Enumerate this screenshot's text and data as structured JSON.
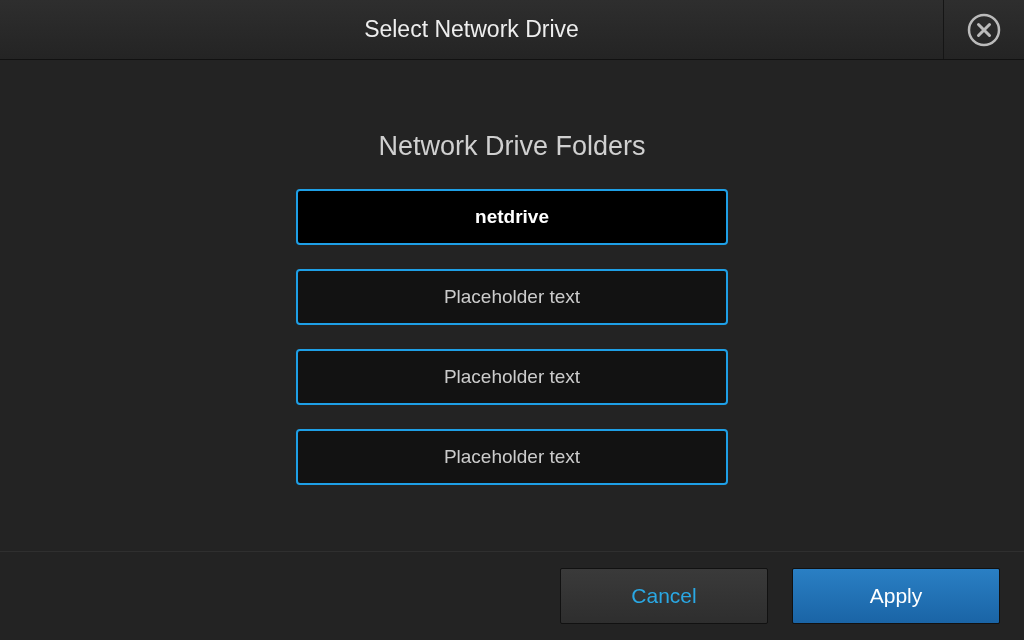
{
  "window": {
    "title": "Select Network Drive"
  },
  "heading": "Network Drive Folders",
  "folders": [
    {
      "label": "netdrive",
      "selected": true
    },
    {
      "label": "Placeholder text",
      "selected": false
    },
    {
      "label": "Placeholder text",
      "selected": false
    },
    {
      "label": "Placeholder text",
      "selected": false
    }
  ],
  "buttons": [
    {
      "label": "Cancel",
      "kind": "secondary"
    },
    {
      "label": "Apply",
      "kind": "primary"
    }
  ]
}
